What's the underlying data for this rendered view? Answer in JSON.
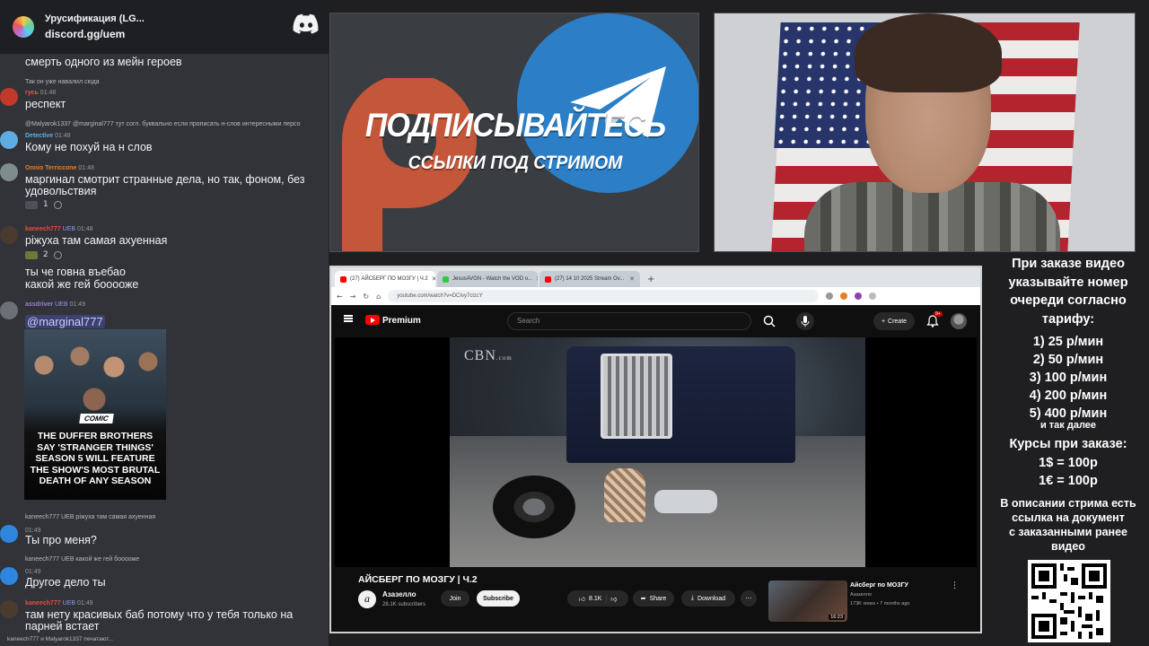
{
  "discord": {
    "server_name": "Урусификация (LG...",
    "invite": "discord.gg/uem",
    "top_partial": "смерть одного из мейн героев",
    "messages": [
      {
        "reply": "Так он уже навалил сюда",
        "author": "гусь",
        "time": "01:48",
        "text": "респект",
        "author_color": "#f5524b"
      },
      {
        "reply": "@Malyarok1337 @marginal777 тут согл. буквально если прописать н-слов интересными персо",
        "author": "Detective",
        "time": "01:48",
        "text": "Кому не похуй на н слов",
        "author_color": "#5dade2"
      },
      {
        "author": "Onnio Terriccone",
        "time": "01:48",
        "text1": "маргинал смотрит странные дела, но так, фоном, без",
        "text2": "удовольствия",
        "reaction_count": "1",
        "author_color": "#e67e22"
      },
      {
        "author": "kaneech777",
        "badge": "UEB",
        "time": "01:48",
        "text": "ріжуха там самая ахуенная",
        "reaction_count": "2",
        "author_color": "#e74c3c"
      },
      {
        "text1": "ты че говна въебао",
        "text2": "какой же гей бооооже"
      },
      {
        "author": "assdriver",
        "badge": "UEB",
        "time": "01:49",
        "mention": "@marginal777",
        "author_color": "#9b7fd4"
      },
      {
        "reply": "kaneech777 UEB ріжуха там самая ахуенная",
        "time": "01:49",
        "text": "Ты про меня?"
      },
      {
        "reply": "kaneech777 UEB какой же гей бооооже",
        "time": "01:49",
        "text": "Другое дело ты"
      },
      {
        "author": "kaneech777",
        "badge": "UEB",
        "time": "01:49",
        "text1": "там нету красивых баб потому что у тебя только на",
        "text2": "парней встает",
        "author_color": "#e74c3c"
      }
    ],
    "news_badge": "COMIC",
    "news_headline": "THE DUFFER BROTHERS SAY 'STRANGER THINGS' SEASON 5 WILL FEATURE THE SHOW'S MOST BRUTAL DEATH OF ANY SEASON",
    "typing": "kaneech777 и Malyarok1337 печатают..."
  },
  "promo": {
    "title": "ПОДПИСЫВАЙТЕСЬ",
    "subtitle": "ССЫЛКИ ПОД СТРИМОМ"
  },
  "browser": {
    "tabs": [
      {
        "label": "(27) АЙСБЕРГ ПО МОЗГУ | Ч.2",
        "favicon_color": "#ff0000"
      },
      {
        "label": "JesusAVGN - Watch the VOD o...",
        "favicon_color": "#2ecc40"
      },
      {
        "label": "(27) 14 10 2025 Stream Ov...",
        "favicon_color": "#ff0000"
      }
    ],
    "url": "youtube.com/watch?v=DCIvy7clzcY",
    "youtube": {
      "brand": "Premium",
      "search_placeholder": "Search",
      "create_label": "Create",
      "notif_badge": "9+",
      "watermark": "CBN",
      "watermark_suffix": ".com",
      "video_title": "АЙСБЕРГ ПО МОЗГУ | Ч.2",
      "channel_name": "Азазелло",
      "channel_initial": "a",
      "subscribers": "28.1K subscribers",
      "join": "Join",
      "subscribe": "Subscribe",
      "likes": "8.1K",
      "share": "Share",
      "download": "Download",
      "rec_title": "Айсберг по МОЗГУ",
      "rec_channel": "Азазелло",
      "rec_stats": "173K views • 7 months ago",
      "rec_duration": "16:23"
    }
  },
  "info": {
    "heading": [
      "При заказе видео",
      "указывайте номер",
      "очереди согласно",
      "тарифу:"
    ],
    "prices": [
      "1) 25 р/мин",
      "2) 50 р/мин",
      "3) 100 р/мин",
      "4) 200 р/мин",
      "5) 400 р/мин"
    ],
    "etc": "и так далее",
    "courses_title": "Курсы при заказе:",
    "courses": [
      "1$ = 100р",
      "1€ = 100р"
    ],
    "note": [
      "В описании стрима есть",
      "ссылка на документ",
      "с заказанными ранее",
      "видео"
    ]
  }
}
